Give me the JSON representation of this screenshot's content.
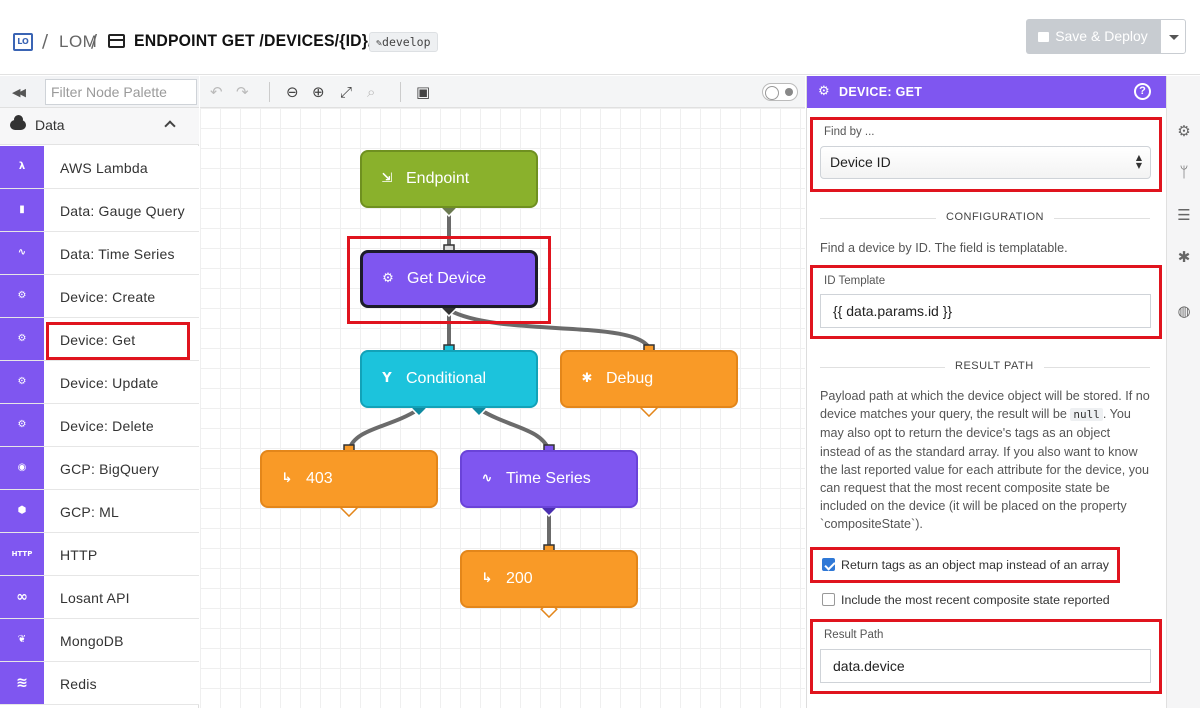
{
  "header": {
    "logo_text": "LO",
    "app_name": "LOM",
    "separator": "/",
    "workflow_title": "ENDPOINT GET /DEVICES/{ID}/DATA",
    "version": "develop",
    "save_label": "Save & Deploy"
  },
  "palette": {
    "filter_placeholder": "Filter Node Palette",
    "category": "Data",
    "items": [
      {
        "label": "AWS Lambda",
        "icon": "lambda-icon",
        "glyph": "λ"
      },
      {
        "label": "Data: Gauge Query",
        "icon": "bar-chart-icon",
        "glyph": "▮"
      },
      {
        "label": "Data: Time Series",
        "icon": "line-chart-icon",
        "glyph": "∿"
      },
      {
        "label": "Device: Create",
        "icon": "device-chip-icon",
        "glyph": "⚙"
      },
      {
        "label": "Device: Get",
        "icon": "device-chip-icon",
        "glyph": "⚙"
      },
      {
        "label": "Device: Update",
        "icon": "device-chip-icon",
        "glyph": "⚙"
      },
      {
        "label": "Device: Delete",
        "icon": "device-chip-icon",
        "glyph": "⚙"
      },
      {
        "label": "GCP: BigQuery",
        "icon": "bigquery-icon",
        "glyph": "◉"
      },
      {
        "label": "GCP: ML",
        "icon": "gcp-ml-icon",
        "glyph": "⬢"
      },
      {
        "label": "HTTP",
        "icon": "http-icon",
        "glyph": "HTTP"
      },
      {
        "label": "Losant API",
        "icon": "losant-api-icon",
        "glyph": "∞"
      },
      {
        "label": "MongoDB",
        "icon": "mongodb-leaf-icon",
        "glyph": "❦"
      },
      {
        "label": "Redis",
        "icon": "redis-stack-icon",
        "glyph": "≋"
      }
    ]
  },
  "canvas_toolbar": {
    "icons": [
      "undo-icon",
      "redo-icon",
      "zoom-out-icon",
      "zoom-in-icon",
      "fit-screen-icon",
      "zoom-reset-icon",
      "add-comment-icon",
      "debug-toggle"
    ]
  },
  "workflow": {
    "nodes": [
      {
        "label": "Endpoint",
        "icon": "endpoint-icon",
        "glyph": "⇲"
      },
      {
        "label": "Get Device",
        "icon": "device-chip-icon",
        "glyph": "⚙"
      },
      {
        "label": "Conditional",
        "icon": "branch-icon",
        "glyph": "Y"
      },
      {
        "label": "Debug",
        "icon": "bug-icon",
        "glyph": "✱"
      },
      {
        "label": "403",
        "icon": "reply-icon",
        "glyph": "↳"
      },
      {
        "label": "Time Series",
        "icon": "line-chart-icon",
        "glyph": "∿"
      },
      {
        "label": "200",
        "icon": "reply-icon",
        "glyph": "↳"
      }
    ]
  },
  "editor": {
    "title": "DEVICE: GET",
    "find_by_label": "Find by ...",
    "find_by_value": "Device ID",
    "configuration_title": "CONFIGURATION",
    "configuration_desc": "Find a device by ID. The field is templatable.",
    "id_template_label": "ID Template",
    "id_template_value": "{{ data.params.id }}",
    "result_path_title": "RESULT PATH",
    "result_desc_1": "Payload path at which the device object will be stored. If no device matches your query, the result will be",
    "result_desc_code": "null",
    "result_desc_2": ". You may also opt to return the device's tags as an object instead of as the standard array. If you also want to know the last reported value for each attribute for the device, you can request that the most recent composite state be included on the device (it will be placed on the property `compositeState`).",
    "checkbox_tags_label": "Return tags as an object map instead of an array",
    "checkbox_tags_checked": true,
    "checkbox_composite_label": "Include the most recent composite state reported",
    "checkbox_composite_checked": false,
    "result_path_label": "Result Path",
    "result_path_value": "data.device"
  },
  "rail": {
    "icons": [
      "settings-gear-icon",
      "version-branch-icon",
      "storage-icon",
      "debug-bug-icon",
      "globe-icon"
    ]
  },
  "colors": {
    "accent_purple": "#7f56f0",
    "endpoint_green": "#8ab12c",
    "conditional_cyan": "#1cc3dc",
    "output_orange": "#f99a27",
    "highlight_red": "#e0141e"
  }
}
